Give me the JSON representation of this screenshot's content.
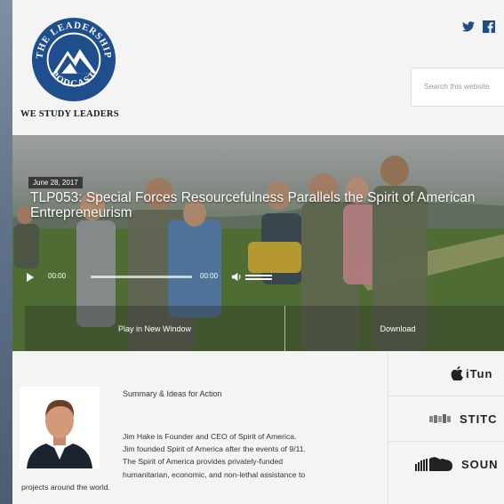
{
  "header": {
    "logo": {
      "arc_top": "THE LEADERSHIP",
      "arc_bottom": "PODCAST",
      "brand_color": "#1f4e8c"
    },
    "tagline": "WE STUDY LEADERS",
    "social": [
      {
        "icon": "twitter-icon"
      },
      {
        "icon": "facebook-icon"
      }
    ],
    "search": {
      "placeholder": "Search this website"
    }
  },
  "episode": {
    "date": "June 28, 2017",
    "title": "TLP053: Special Forces Resourcefulness Parallels the Spirit of American Entrepreneurism",
    "player": {
      "current_time": "00:00",
      "duration": "00:00",
      "progress": 0
    },
    "play_in_window_label": "Play in New Window",
    "download_label": "Download"
  },
  "summary": {
    "title": "Summary & Ideas for Action",
    "line1": "Jim Hake is Founder and CEO of Spirit of America.",
    "line2": "Jim founded Spirit of America after the events of 9/11.",
    "line3": "The Spirit of America provides privately-funded",
    "line4": "humanitarian, economic, and non-lethal assistance to",
    "line5": "projects around the world."
  },
  "subscribe": [
    {
      "label": "iTun",
      "icon": "apple-icon"
    },
    {
      "label": "STITC",
      "icon": "stitcher-icon"
    },
    {
      "label": "SOUN",
      "icon": "soundcloud-icon"
    }
  ]
}
